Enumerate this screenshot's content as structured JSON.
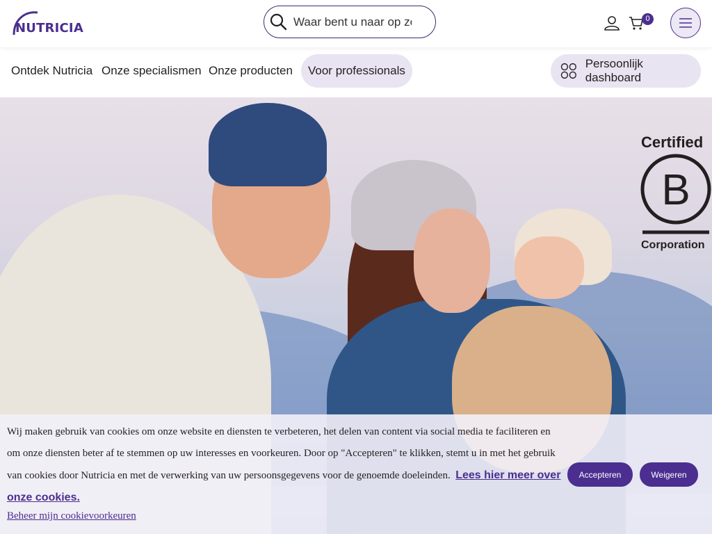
{
  "header": {
    "logo_text": "NUTRICIA",
    "search_placeholder": "Waar bent u naar op zoe",
    "cart_count": "0",
    "icons": [
      "search-icon",
      "user-icon",
      "cart-icon",
      "hamburger-menu-icon"
    ]
  },
  "nav": {
    "items": [
      {
        "label": "Ontdek Nutricia"
      },
      {
        "label": "Onze specialismen"
      },
      {
        "label": "Onze producten"
      },
      {
        "label": "Voor professionals"
      }
    ],
    "dashboard_label": "Persoonlijk dashboard"
  },
  "hero": {
    "badge_top": "Certified",
    "badge_letter": "B",
    "badge_bottom": "Corporation"
  },
  "cookie": {
    "text": "Wij maken gebruik van cookies om onze website en diensten te verbeteren, het delen van content via social media te faciliteren en om onze diensten beter af te stemmen op uw interesses en voorkeuren. Door op \"Accepteren\" te klikken, stemt u in met het gebruik van cookies door Nutricia en met de verwerking van uw persoonsgegevens voor de genoemde doeleinden.",
    "more_link": "Lees hier meer over onze cookies.",
    "manage_link": "Beheer mijn cookievoorkeuren",
    "accept_label": "Accepteren",
    "decline_label": "Weigeren"
  },
  "colors": {
    "brand": "#4b2e8f",
    "pill_bg": "#e9e4f1"
  }
}
